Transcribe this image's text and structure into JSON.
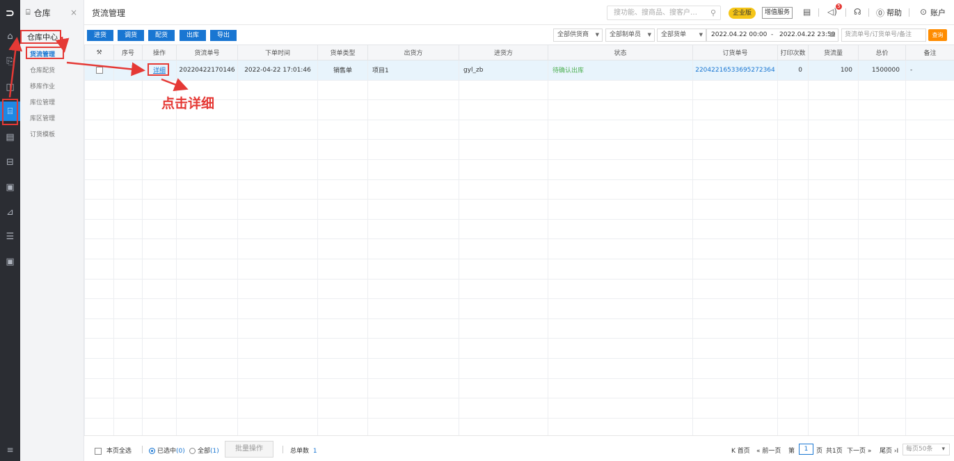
{
  "rail": {
    "logo": "⊃",
    "items": [
      {
        "icon": "home-icon",
        "glyph": "⌂"
      },
      {
        "icon": "goods-icon",
        "glyph": "⎘"
      },
      {
        "icon": "money-icon",
        "glyph": "◫"
      },
      {
        "icon": "warehouse-icon",
        "glyph": "⌸",
        "active": true
      },
      {
        "icon": "report-icon",
        "glyph": "▤"
      },
      {
        "icon": "finance-icon",
        "glyph": "⊟"
      },
      {
        "icon": "card-icon",
        "glyph": "▣"
      },
      {
        "icon": "chart-icon",
        "glyph": "⊿"
      },
      {
        "icon": "settings-icon",
        "glyph": "☰"
      },
      {
        "icon": "apps-icon",
        "glyph": "▣"
      }
    ],
    "bottom_glyph": "≡"
  },
  "sidebar": {
    "title": "仓库",
    "close_glyph": "×",
    "group": "仓库中心",
    "items": [
      "货流管理",
      "仓库配货",
      "移库作业",
      "库位管理",
      "库区管理",
      "订货模板"
    ]
  },
  "topbar": {
    "title": "货流管理",
    "search_placeholder": "搜功能、搜商品、搜客户…",
    "edition": "企业版",
    "vip_service": "增值服务",
    "notif_count": "5",
    "help": "帮助",
    "account": "账户"
  },
  "toolbar": {
    "buttons": [
      "进货",
      "调货",
      "配货",
      "出库",
      "导出"
    ],
    "filters": [
      "全部供货商",
      "全部制单员",
      "全部货单"
    ],
    "date_start": "2022.04.22 00:00",
    "date_sep": "-",
    "date_end": "2022.04.22 23:59",
    "search_placeholder": "货流单号/订货单号/备注",
    "query": "查询"
  },
  "table": {
    "headers": [
      "序号",
      "操作",
      "货流单号",
      "下单时间",
      "货单类型",
      "出货方",
      "进货方",
      "状态",
      "订货单号",
      "打印次数",
      "货流量",
      "总价",
      "备注"
    ],
    "rows": [
      {
        "op": "详细",
        "flow_no": "20220422170146",
        "time": "2022-04-22 17:01:46",
        "type": "销售单",
        "from": "项目1",
        "to": "gyl_zb",
        "status": "待确认出库",
        "order_no": "22042216533695272364",
        "print_count": "0",
        "qty": "100",
        "total": "1500000",
        "note": "-"
      }
    ]
  },
  "footer": {
    "select_page": "本页全选",
    "selected_label": "已选中",
    "selected_count": "(0)",
    "all_label": "全部",
    "all_count": "(1)",
    "batch": "批量操作",
    "total_label": "总单数",
    "total_value": "1",
    "first": "K 首页",
    "prev": "« 前一页",
    "page_prefix": "第",
    "page": "1",
    "page_suffix": "页",
    "page_total": "共1页",
    "next": "下一页 »",
    "last": "尾页 ›I",
    "per_page": "每页50条"
  },
  "annotation": {
    "text": "点击详细",
    "color": "#e53935"
  },
  "colors": {
    "primary": "#1976d2",
    "query": "#ff8c00",
    "rail": "#2b2d33",
    "status": "#4caf50"
  }
}
